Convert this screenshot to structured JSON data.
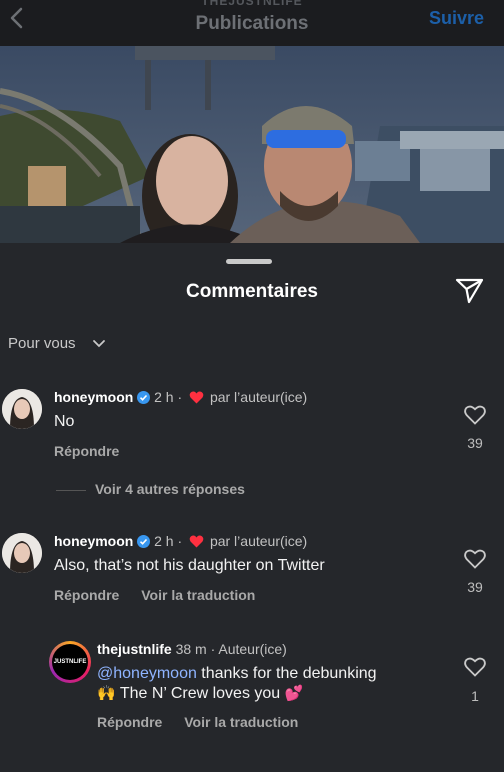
{
  "header": {
    "account_label": "THEJUSTNLIFE",
    "title": "Publications",
    "follow_label": "Suivre"
  },
  "sheet": {
    "title": "Commentaires",
    "filter_label": "Pour vous"
  },
  "comments": [
    {
      "username": "honeymoon",
      "time": "2 h",
      "liked_by": "par l’auteur(ice)",
      "text": "No",
      "reply_label": "Répondre",
      "likes": "39",
      "more_replies": "Voir 4 autres réponses"
    },
    {
      "username": "honeymoon",
      "time": "2 h",
      "liked_by": "par l’auteur(ice)",
      "text": "Also, that’s not his daughter on Twitter",
      "reply_label": "Répondre",
      "translate_label": "Voir la traduction",
      "likes": "39"
    },
    {
      "username": "thejustnlife",
      "time": "38 m",
      "role": "Auteur(ice)",
      "avatar_text": "JUSTNLIFE",
      "mention": "@honeymoon",
      "text_1": " thanks for the debunking",
      "emoji_1": "🙌",
      "text_2": " The N’ Crew loves you ",
      "emoji_2": "💕",
      "reply_label": "Répondre",
      "translate_label": "Voir la traduction",
      "likes": "1"
    }
  ],
  "colors": {
    "background": "#25272b",
    "follow": "#1c5fa8",
    "verified": "#3897f0",
    "heart": "#ff3040",
    "mention": "#8fb4ff"
  }
}
